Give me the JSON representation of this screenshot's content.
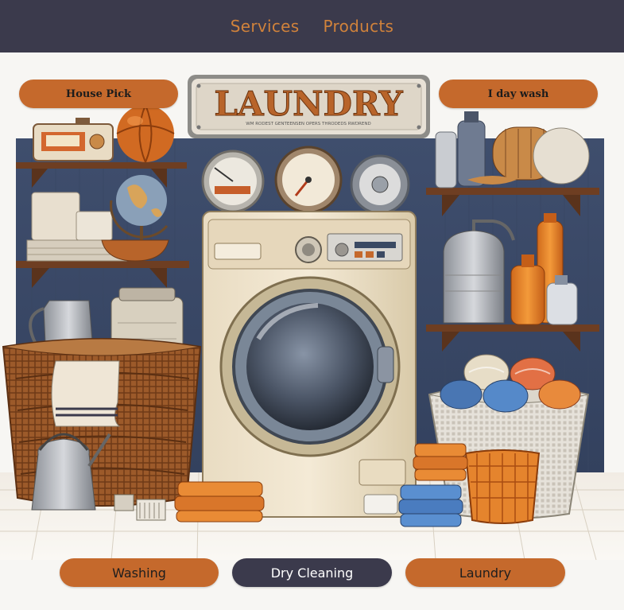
{
  "nav": {
    "items": [
      {
        "label": "Services"
      },
      {
        "label": "Products"
      }
    ]
  },
  "hero": {
    "sign_text": "LAUNDRY",
    "sign_subtext": "WM RODEST GENTEENSEN OPERS THRODEDS RWDREND",
    "top_buttons": {
      "house_pick": "House Pick",
      "one_day_wash": "I day wash"
    }
  },
  "bottom_buttons": {
    "washing": "Washing",
    "dry_cleaning": "Dry Cleaning",
    "laundry": "Laundry"
  },
  "colors": {
    "nav_bg": "#3b3a4c",
    "accent_orange": "#c5692c",
    "nav_text": "#d0823b"
  }
}
